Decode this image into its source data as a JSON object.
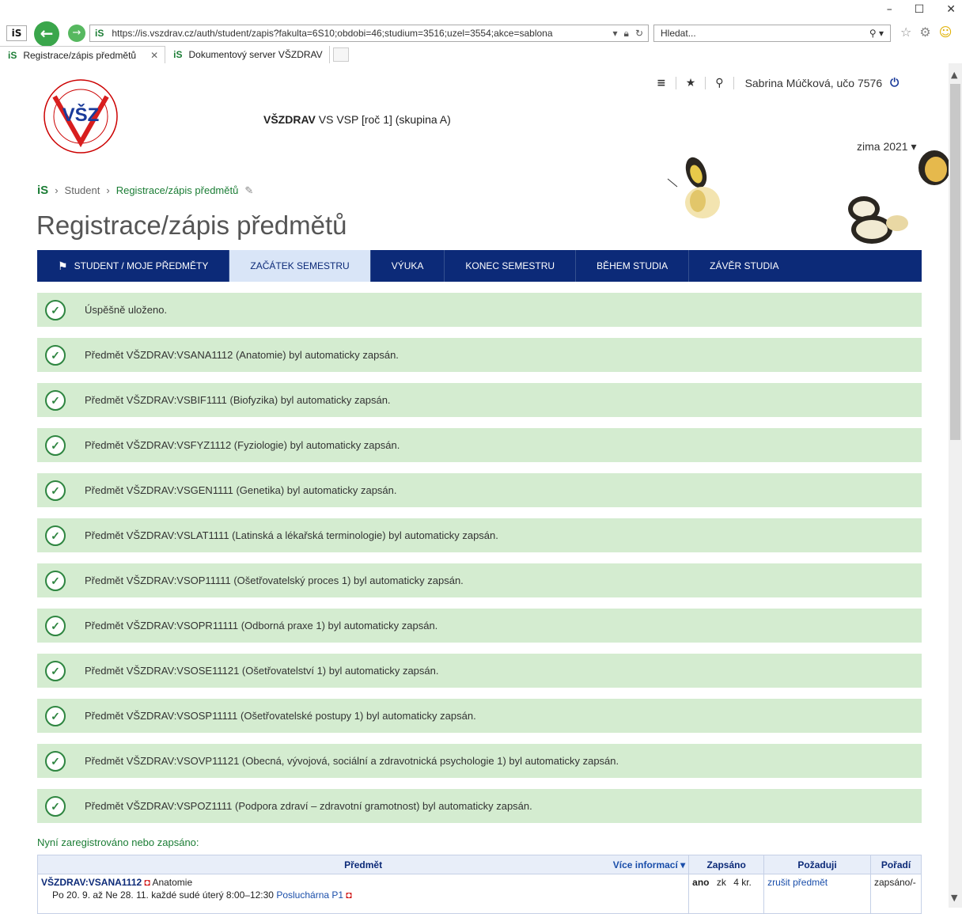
{
  "browser": {
    "url": "https://is.vszdrav.cz/auth/student/zapis?fakulta=6S10;obdobi=46;studium=3516;uzel=3554;akce=sablona",
    "search_placeholder": "Hledat...",
    "tabs": [
      {
        "label": "Registrace/zápis předmětů",
        "active": true
      },
      {
        "label": "Dokumentový server VŠZDRAV",
        "active": false
      }
    ]
  },
  "header": {
    "user": "Sabrina Múčková, učo 7576",
    "faculty_bold": "VŠZDRAV",
    "faculty_rest": " VS VSP [roč 1] (skupina A)",
    "period": "zima 2021 ▾",
    "logo_text": "VŠZ"
  },
  "breadcrumb": {
    "root": "Student",
    "current": "Registrace/zápis předmětů"
  },
  "page_title": "Registrace/zápis předmětů",
  "mainnav": [
    {
      "label": "STUDENT / MOJE PŘEDMĚTY",
      "active": false
    },
    {
      "label": "ZAČÁTEK SEMESTRU",
      "active": true
    },
    {
      "label": "VÝUKA",
      "active": false
    },
    {
      "label": "KONEC SEMESTRU",
      "active": false
    },
    {
      "label": "BĚHEM STUDIA",
      "active": false
    },
    {
      "label": "ZÁVĚR STUDIA",
      "active": false
    }
  ],
  "alerts": [
    "Úspěšně uloženo.",
    "Předmět VŠZDRAV:VSANA1112 (Anatomie) byl automaticky zapsán.",
    "Předmět VŠZDRAV:VSBIF1111 (Biofyzika) byl automaticky zapsán.",
    "Předmět VŠZDRAV:VSFYZ1112 (Fyziologie) byl automaticky zapsán.",
    "Předmět VŠZDRAV:VSGEN1111 (Genetika) byl automaticky zapsán.",
    "Předmět VŠZDRAV:VSLAT1111 (Latinská a lékařská terminologie) byl automaticky zapsán.",
    "Předmět VŠZDRAV:VSOP11111 (Ošetřovatelský proces 1) byl automaticky zapsán.",
    "Předmět VŠZDRAV:VSOPR11111 (Odborná praxe 1) byl automaticky zapsán.",
    "Předmět VŠZDRAV:VSOSE11121 (Ošetřovatelství 1) byl automaticky zapsán.",
    "Předmět VŠZDRAV:VSOSP11111 (Ošetřovatelské postupy 1) byl automaticky zapsán.",
    "Předmět VŠZDRAV:VSOVP11121 (Obecná, vývojová, sociální a zdravotnická psychologie 1) byl automaticky zapsán.",
    "Předmět VŠZDRAV:VSPOZ1111 (Podpora zdraví – zdravotní gramotnost) byl automaticky zapsán."
  ],
  "enrolled_heading": "Nyní zaregistrováno nebo zapsáno:",
  "table": {
    "headers": {
      "subject": "Předmět",
      "more_info": "Více informací ▾",
      "enrolled": "Zapsáno",
      "request": "Požaduji",
      "order": "Pořadí"
    },
    "rows": [
      {
        "code": "VŠZDRAV:VSANA1112",
        "name": "Anatomie",
        "schedule": "Po 20. 9. až Ne 28. 11. každé sudé úterý 8:00–12:30",
        "room": "Posluchárna P1",
        "enrolled": "ano",
        "completion": "zk",
        "credits": "4 kr.",
        "action": "zrušit předmět",
        "order": "zapsáno/-"
      }
    ]
  },
  "colors": {
    "nav_bg": "#0c2a78",
    "alert_bg": "#d4ecd0",
    "accent_green": "#1b7d35"
  }
}
